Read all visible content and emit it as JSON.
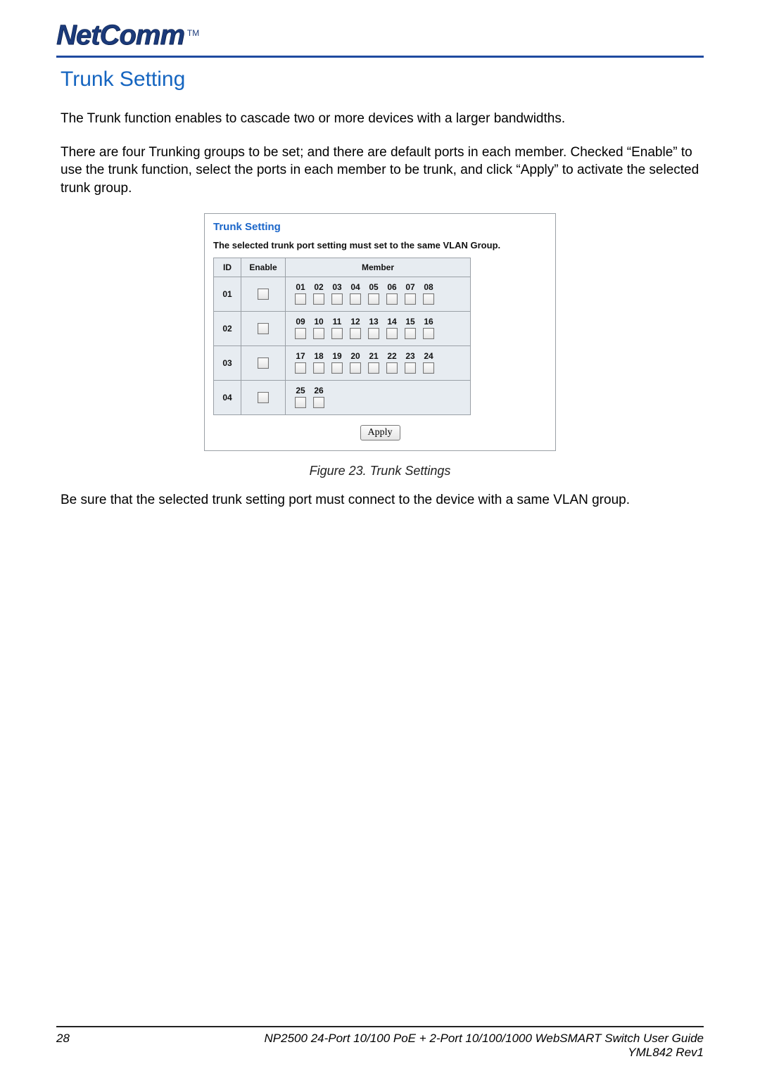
{
  "brand": {
    "name": "NetComm",
    "tm": "TM"
  },
  "title": "Trunk Setting",
  "para1": "The Trunk function enables to cascade two or more devices with a larger bandwidths.",
  "para2": "There are four Trunking groups to be set; and there are default ports in each member. Checked “Enable” to use the trunk function, select the ports in each member to be trunk, and click “Apply” to activate the selected trunk group.",
  "panel": {
    "title": "Trunk Setting",
    "note": "The selected trunk port setting must set to the same VLAN Group.",
    "headers": {
      "id": "ID",
      "enable": "Enable",
      "member": "Member"
    },
    "rows": [
      {
        "id": "01",
        "ports": [
          "01",
          "02",
          "03",
          "04",
          "05",
          "06",
          "07",
          "08"
        ]
      },
      {
        "id": "02",
        "ports": [
          "09",
          "10",
          "11",
          "12",
          "13",
          "14",
          "15",
          "16"
        ]
      },
      {
        "id": "03",
        "ports": [
          "17",
          "18",
          "19",
          "20",
          "21",
          "22",
          "23",
          "24"
        ]
      },
      {
        "id": "04",
        "ports": [
          "25",
          "26"
        ]
      }
    ],
    "apply": "Apply"
  },
  "caption": "Figure 23. Trunk Settings",
  "para3": "Be sure that the selected trunk setting port must connect to the device with a same VLAN group.",
  "footer": {
    "page": "28",
    "line1": "NP2500 24-Port 10/100 PoE + 2-Port 10/100/1000 WebSMART Switch User Guide",
    "line2": "YML842 Rev1"
  }
}
